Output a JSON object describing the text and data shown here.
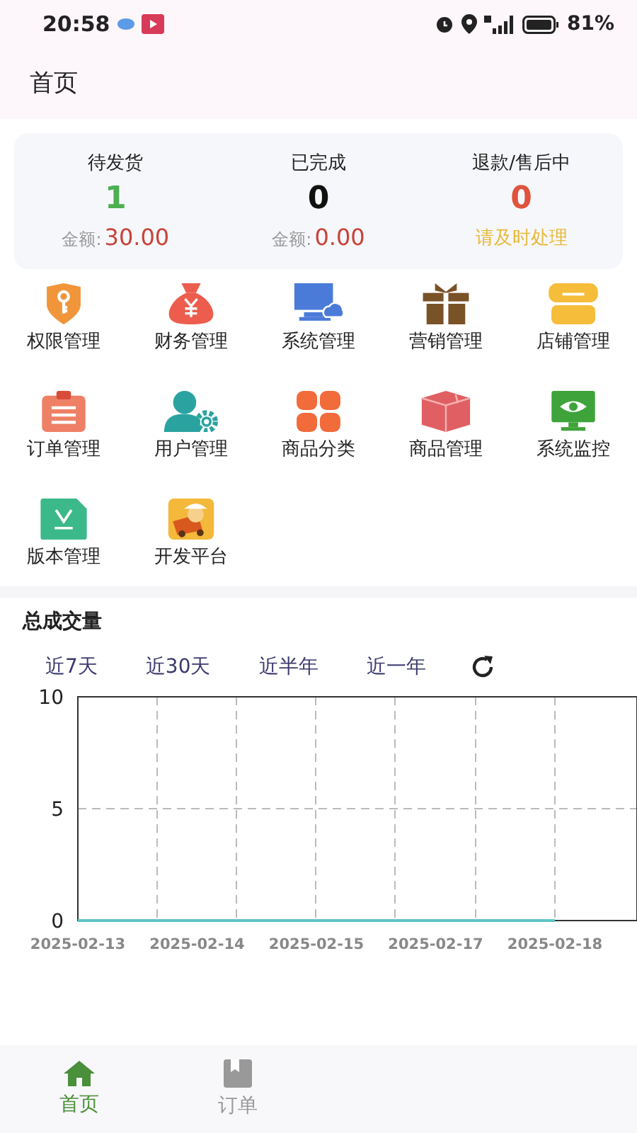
{
  "status_bar": {
    "time": "20:58",
    "battery": "81%"
  },
  "header": {
    "title": "首页"
  },
  "summary": [
    {
      "label": "待发货",
      "count": "1",
      "color": "#4caf50",
      "note_label": "金额:",
      "note_value": "30.00"
    },
    {
      "label": "已完成",
      "count": "0",
      "color": "#111111",
      "note_label": "金额:",
      "note_value": "0.00"
    },
    {
      "label": "退款/售后中",
      "count": "0",
      "color": "#e0533c",
      "hint": "请及时处理"
    }
  ],
  "menu": [
    {
      "label": "权限管理",
      "kind": "shield"
    },
    {
      "label": "财务管理",
      "kind": "moneybag"
    },
    {
      "label": "系统管理",
      "kind": "monitor"
    },
    {
      "label": "营销管理",
      "kind": "gift"
    },
    {
      "label": "店铺管理",
      "kind": "store"
    },
    {
      "label": "订单管理",
      "kind": "clipboard"
    },
    {
      "label": "用户管理",
      "kind": "user"
    },
    {
      "label": "商品分类",
      "kind": "grid"
    },
    {
      "label": "商品管理",
      "kind": "box"
    },
    {
      "label": "系统监控",
      "kind": "eye"
    },
    {
      "label": "版本管理",
      "kind": "file"
    },
    {
      "label": "开发平台",
      "kind": "truck"
    }
  ],
  "sales": {
    "title": "总成交量",
    "ranges": [
      {
        "label": "近7天",
        "selected": false
      },
      {
        "label": "近30天",
        "selected": false
      },
      {
        "label": "近半年",
        "selected": false
      },
      {
        "label": "近一年",
        "selected": false
      }
    ],
    "chart_data": {
      "type": "line",
      "categories": [
        "2025-02-13",
        "2025-02-14",
        "2025-02-15",
        "2025-02-17",
        "2025-02-18"
      ],
      "series": [
        {
          "color": "#5fc4c4",
          "values": [
            0,
            0,
            0,
            0,
            0
          ]
        }
      ],
      "ylim": [
        0,
        10
      ],
      "grid": true,
      "yticks": [
        0,
        5,
        10
      ]
    }
  },
  "tabs": [
    {
      "label": "首页",
      "selected": true,
      "kind": "home"
    },
    {
      "label": "订单",
      "selected": false,
      "kind": "orders"
    }
  ]
}
